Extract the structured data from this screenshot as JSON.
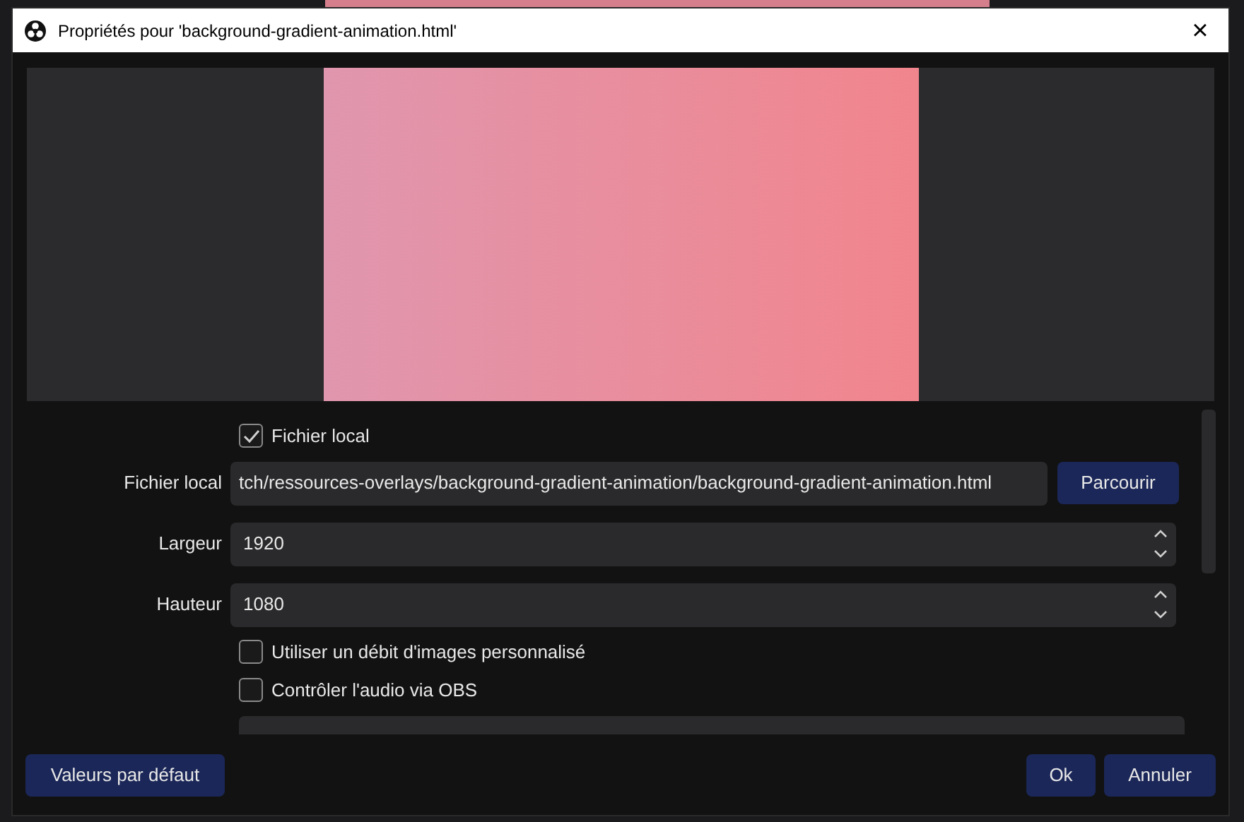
{
  "window": {
    "title": "Propriétés pour 'background-gradient-animation.html'",
    "close": "×"
  },
  "properties": [
    {
      "kind": "checkbox",
      "label": "Fichier local",
      "checked": true
    },
    {
      "kind": "file",
      "label": "Fichier local",
      "value": "tch/ressources-overlays/background-gradient-animation/background-gradient-animation.html",
      "button": "Parcourir"
    },
    {
      "kind": "spin",
      "label": "Largeur",
      "value": "1920"
    },
    {
      "kind": "spin",
      "label": "Hauteur",
      "value": "1080"
    },
    {
      "kind": "checkbox",
      "label": "Utiliser un débit d'images personnalisé",
      "checked": false
    },
    {
      "kind": "checkbox",
      "label": "Contrôler l'audio via OBS",
      "checked": false
    },
    {
      "kind": "partial"
    }
  ],
  "buttons": {
    "defaults": "Valeurs par défaut",
    "ok": "Ok",
    "cancel": "Annuler"
  }
}
